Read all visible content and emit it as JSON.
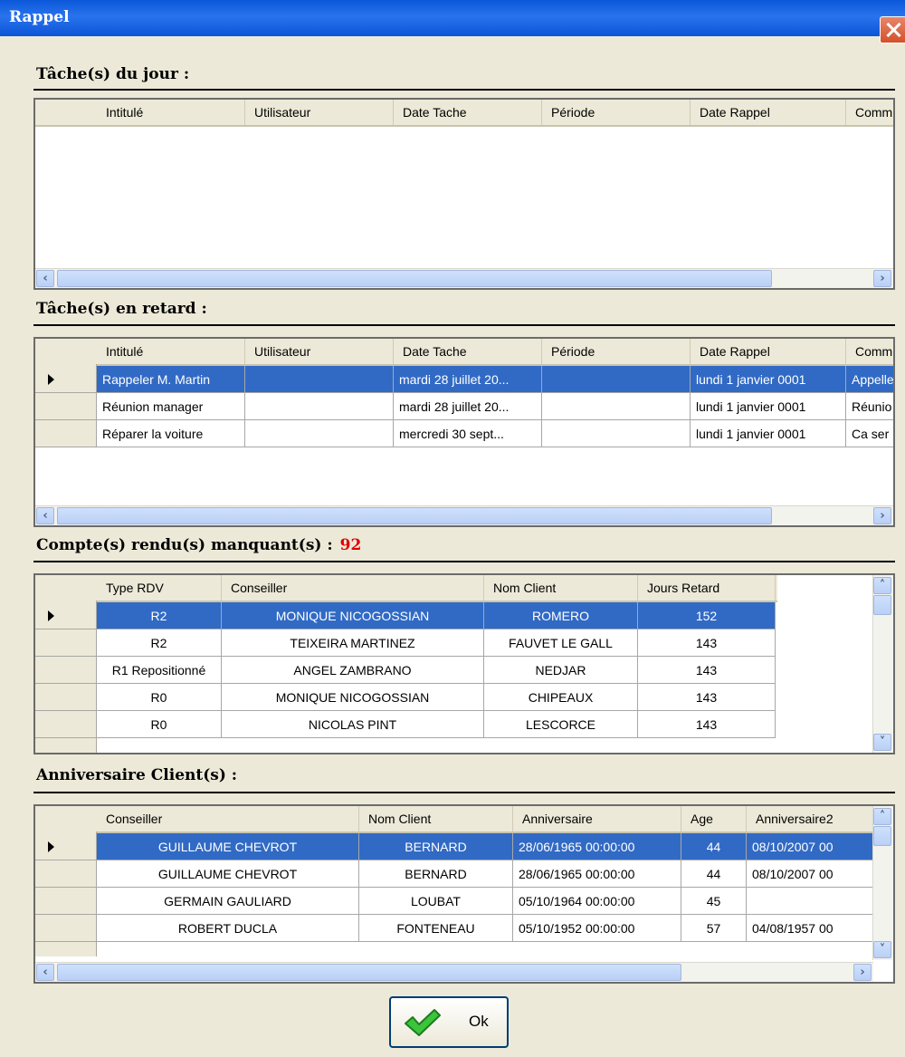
{
  "window": {
    "title": "Rappel"
  },
  "sections": {
    "today": {
      "title": "Tâche(s) du jour :"
    },
    "late": {
      "title": "Tâche(s) en retard :"
    },
    "reports": {
      "title": "Compte(s) rendu(s) manquant(s) :",
      "count": "92"
    },
    "birthdays": {
      "title": "Anniversaire Client(s) :"
    }
  },
  "tasks_columns": [
    "Intitulé",
    "Utilisateur",
    "Date Tache",
    "Période",
    "Date Rappel",
    "Comm"
  ],
  "late_tasks": [
    [
      "Rappeler M. Martin",
      "",
      "mardi 28 juillet 20...",
      "",
      "lundi 1 janvier 0001",
      "Appelle"
    ],
    [
      "Réunion manager",
      "",
      "mardi 28 juillet 20...",
      "",
      "lundi 1 janvier 0001",
      "Réunio"
    ],
    [
      "Réparer la voiture",
      "",
      "mercredi 30 sept...",
      "",
      "lundi 1 janvier 0001",
      "Ca ser"
    ]
  ],
  "reports_columns": [
    "Type RDV",
    "Conseiller",
    "Nom Client",
    "Jours Retard"
  ],
  "reports_rows": [
    [
      "R2",
      "MONIQUE NICOGOSSIAN",
      "ROMERO",
      "152"
    ],
    [
      "R2",
      "TEIXEIRA MARTINEZ",
      "FAUVET LE GALL",
      "143"
    ],
    [
      "R1 Repositionné",
      "ANGEL ZAMBRANO",
      "NEDJAR",
      "143"
    ],
    [
      "R0",
      "MONIQUE NICOGOSSIAN",
      "CHIPEAUX",
      "143"
    ],
    [
      "R0",
      "NICOLAS PINT",
      "LESCORCE",
      "143"
    ]
  ],
  "birthday_columns": [
    "Conseiller",
    "Nom Client",
    "Anniversaire",
    "Age",
    "Anniversaire2"
  ],
  "birthday_rows": [
    [
      "GUILLAUME CHEVROT",
      "BERNARD",
      "28/06/1965 00:00:00",
      "44",
      "08/10/2007 00"
    ],
    [
      "GUILLAUME CHEVROT",
      "BERNARD",
      "28/06/1965 00:00:00",
      "44",
      "08/10/2007 00"
    ],
    [
      "GERMAIN GAULIARD",
      "LOUBAT",
      "05/10/1964 00:00:00",
      "45",
      ""
    ],
    [
      "ROBERT DUCLA",
      "FONTENEAU",
      "05/10/1952 00:00:00",
      "57",
      "04/08/1957 00"
    ]
  ],
  "buttons": {
    "ok": "Ok"
  },
  "icons": {
    "close": "close-icon",
    "ok": "checkmark-icon",
    "row_indicator": "row-pointer-icon"
  },
  "colors": {
    "selection": "#316ac5",
    "count": "#e00000",
    "titlebar": "#0a57d8"
  }
}
